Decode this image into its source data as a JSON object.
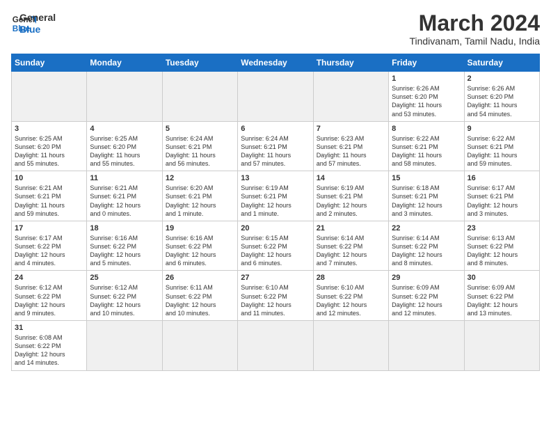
{
  "header": {
    "logo_general": "General",
    "logo_blue": "Blue",
    "title": "March 2024",
    "subtitle": "Tindivanam, Tamil Nadu, India"
  },
  "weekdays": [
    "Sunday",
    "Monday",
    "Tuesday",
    "Wednesday",
    "Thursday",
    "Friday",
    "Saturday"
  ],
  "weeks": [
    [
      {
        "day": "",
        "info": "",
        "empty": true
      },
      {
        "day": "",
        "info": "",
        "empty": true
      },
      {
        "day": "",
        "info": "",
        "empty": true
      },
      {
        "day": "",
        "info": "",
        "empty": true
      },
      {
        "day": "",
        "info": "",
        "empty": true
      },
      {
        "day": "1",
        "info": "Sunrise: 6:26 AM\nSunset: 6:20 PM\nDaylight: 11 hours\nand 53 minutes."
      },
      {
        "day": "2",
        "info": "Sunrise: 6:26 AM\nSunset: 6:20 PM\nDaylight: 11 hours\nand 54 minutes."
      }
    ],
    [
      {
        "day": "3",
        "info": "Sunrise: 6:25 AM\nSunset: 6:20 PM\nDaylight: 11 hours\nand 55 minutes."
      },
      {
        "day": "4",
        "info": "Sunrise: 6:25 AM\nSunset: 6:20 PM\nDaylight: 11 hours\nand 55 minutes."
      },
      {
        "day": "5",
        "info": "Sunrise: 6:24 AM\nSunset: 6:21 PM\nDaylight: 11 hours\nand 56 minutes."
      },
      {
        "day": "6",
        "info": "Sunrise: 6:24 AM\nSunset: 6:21 PM\nDaylight: 11 hours\nand 57 minutes."
      },
      {
        "day": "7",
        "info": "Sunrise: 6:23 AM\nSunset: 6:21 PM\nDaylight: 11 hours\nand 57 minutes."
      },
      {
        "day": "8",
        "info": "Sunrise: 6:22 AM\nSunset: 6:21 PM\nDaylight: 11 hours\nand 58 minutes."
      },
      {
        "day": "9",
        "info": "Sunrise: 6:22 AM\nSunset: 6:21 PM\nDaylight: 11 hours\nand 59 minutes."
      }
    ],
    [
      {
        "day": "10",
        "info": "Sunrise: 6:21 AM\nSunset: 6:21 PM\nDaylight: 11 hours\nand 59 minutes."
      },
      {
        "day": "11",
        "info": "Sunrise: 6:21 AM\nSunset: 6:21 PM\nDaylight: 12 hours\nand 0 minutes."
      },
      {
        "day": "12",
        "info": "Sunrise: 6:20 AM\nSunset: 6:21 PM\nDaylight: 12 hours\nand 1 minute."
      },
      {
        "day": "13",
        "info": "Sunrise: 6:19 AM\nSunset: 6:21 PM\nDaylight: 12 hours\nand 1 minute."
      },
      {
        "day": "14",
        "info": "Sunrise: 6:19 AM\nSunset: 6:21 PM\nDaylight: 12 hours\nand 2 minutes."
      },
      {
        "day": "15",
        "info": "Sunrise: 6:18 AM\nSunset: 6:21 PM\nDaylight: 12 hours\nand 3 minutes."
      },
      {
        "day": "16",
        "info": "Sunrise: 6:17 AM\nSunset: 6:21 PM\nDaylight: 12 hours\nand 3 minutes."
      }
    ],
    [
      {
        "day": "17",
        "info": "Sunrise: 6:17 AM\nSunset: 6:22 PM\nDaylight: 12 hours\nand 4 minutes."
      },
      {
        "day": "18",
        "info": "Sunrise: 6:16 AM\nSunset: 6:22 PM\nDaylight: 12 hours\nand 5 minutes."
      },
      {
        "day": "19",
        "info": "Sunrise: 6:16 AM\nSunset: 6:22 PM\nDaylight: 12 hours\nand 6 minutes."
      },
      {
        "day": "20",
        "info": "Sunrise: 6:15 AM\nSunset: 6:22 PM\nDaylight: 12 hours\nand 6 minutes."
      },
      {
        "day": "21",
        "info": "Sunrise: 6:14 AM\nSunset: 6:22 PM\nDaylight: 12 hours\nand 7 minutes."
      },
      {
        "day": "22",
        "info": "Sunrise: 6:14 AM\nSunset: 6:22 PM\nDaylight: 12 hours\nand 8 minutes."
      },
      {
        "day": "23",
        "info": "Sunrise: 6:13 AM\nSunset: 6:22 PM\nDaylight: 12 hours\nand 8 minutes."
      }
    ],
    [
      {
        "day": "24",
        "info": "Sunrise: 6:12 AM\nSunset: 6:22 PM\nDaylight: 12 hours\nand 9 minutes."
      },
      {
        "day": "25",
        "info": "Sunrise: 6:12 AM\nSunset: 6:22 PM\nDaylight: 12 hours\nand 10 minutes."
      },
      {
        "day": "26",
        "info": "Sunrise: 6:11 AM\nSunset: 6:22 PM\nDaylight: 12 hours\nand 10 minutes."
      },
      {
        "day": "27",
        "info": "Sunrise: 6:10 AM\nSunset: 6:22 PM\nDaylight: 12 hours\nand 11 minutes."
      },
      {
        "day": "28",
        "info": "Sunrise: 6:10 AM\nSunset: 6:22 PM\nDaylight: 12 hours\nand 12 minutes."
      },
      {
        "day": "29",
        "info": "Sunrise: 6:09 AM\nSunset: 6:22 PM\nDaylight: 12 hours\nand 12 minutes."
      },
      {
        "day": "30",
        "info": "Sunrise: 6:09 AM\nSunset: 6:22 PM\nDaylight: 12 hours\nand 13 minutes."
      }
    ],
    [
      {
        "day": "31",
        "info": "Sunrise: 6:08 AM\nSunset: 6:22 PM\nDaylight: 12 hours\nand 14 minutes."
      },
      {
        "day": "",
        "info": "",
        "empty": true
      },
      {
        "day": "",
        "info": "",
        "empty": true
      },
      {
        "day": "",
        "info": "",
        "empty": true
      },
      {
        "day": "",
        "info": "",
        "empty": true
      },
      {
        "day": "",
        "info": "",
        "empty": true
      },
      {
        "day": "",
        "info": "",
        "empty": true
      }
    ]
  ]
}
